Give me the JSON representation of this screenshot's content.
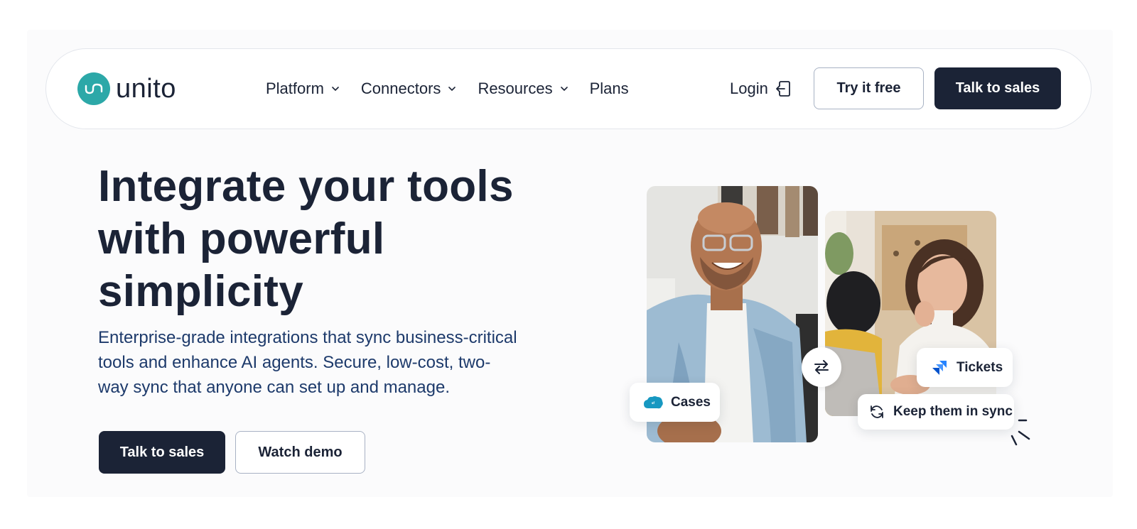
{
  "brand": {
    "name": "unito",
    "accent": "#2ca8a8",
    "dark": "#1b2336"
  },
  "nav": {
    "items": [
      {
        "label": "Platform",
        "has_dropdown": true
      },
      {
        "label": "Connectors",
        "has_dropdown": true
      },
      {
        "label": "Resources",
        "has_dropdown": true
      },
      {
        "label": "Plans",
        "has_dropdown": false
      }
    ],
    "login_label": "Login",
    "try_free_label": "Try it free",
    "talk_sales_label": "Talk to sales"
  },
  "hero": {
    "title_line1": "Integrate your tools",
    "title_line2": "with powerful",
    "title_line3": "simplicity",
    "subtitle": "Enterprise-grade integrations that sync business-critical tools and enhance AI agents. Secure, low-cost, two-way sync that anyone can set up and manage.",
    "primary_cta": "Talk to sales",
    "secondary_cta": "Watch demo"
  },
  "visual": {
    "chip_cases": "Cases",
    "chip_tickets": "Tickets",
    "chip_sync": "Keep them in sync",
    "icons": [
      "salesforce-icon",
      "jira-icon",
      "sync-icon",
      "swap-arrows-icon"
    ]
  }
}
